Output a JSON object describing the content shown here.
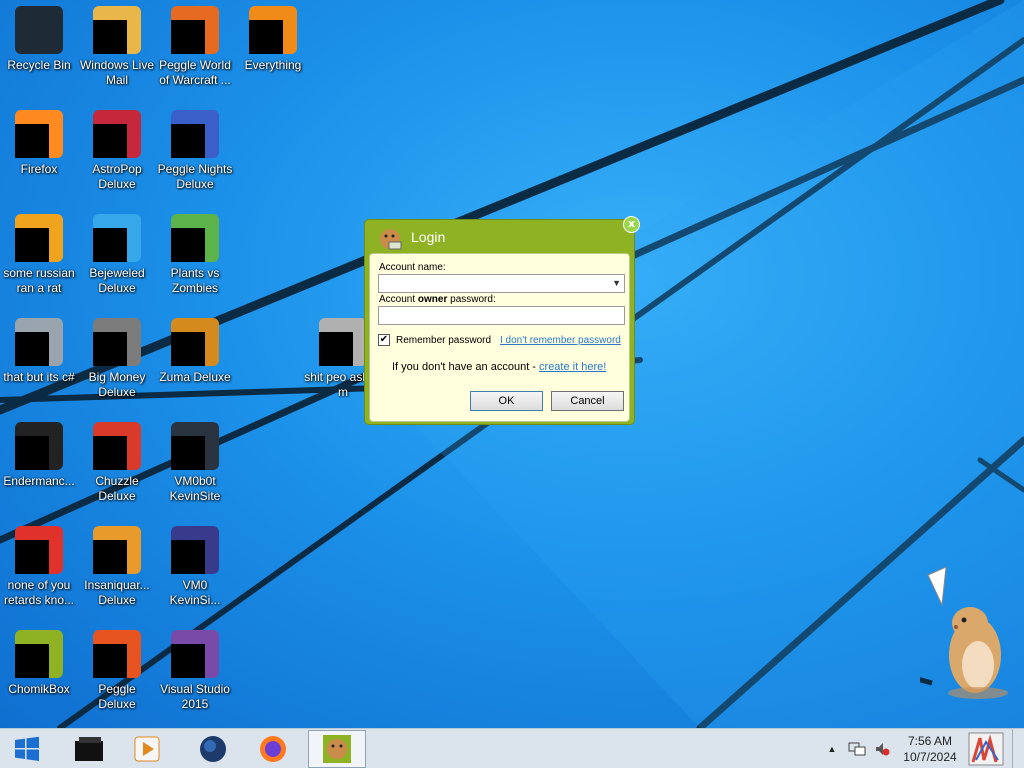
{
  "desktop": {
    "icons": [
      {
        "label": "Recycle Bin",
        "icon": "recycle-bin-icon",
        "color": "#1e2a36"
      },
      {
        "label": "Windows Live Mail",
        "icon": "mail-icon",
        "color": "#e9b64a"
      },
      {
        "label": "Peggle World of Warcraft ...",
        "icon": "peggle-icon",
        "color": "#e66a1f"
      },
      {
        "label": "Everything",
        "icon": "search-magnifier-icon",
        "color": "#f08a18"
      },
      {
        "label": "Firefox",
        "icon": "firefox-icon",
        "color": "#ff8a1f"
      },
      {
        "label": "AstroPop Deluxe",
        "icon": "astropop-icon",
        "color": "#c4283a"
      },
      {
        "label": "Peggle Nights Deluxe",
        "icon": "peggle-nights-icon",
        "color": "#3a5fc8"
      },
      {
        "label": "some russian ran a rat",
        "icon": "app-icon",
        "color": "#f0a41e"
      },
      {
        "label": "Bejeweled Deluxe",
        "icon": "gem-icon",
        "color": "#36a7e8"
      },
      {
        "label": "Plants vs Zombies",
        "icon": "plant-icon",
        "color": "#5bb34a"
      },
      {
        "label": "that but its c#",
        "icon": "window-stack-icon",
        "color": "#9aa4ae"
      },
      {
        "label": "Big Money Deluxe",
        "icon": "money-icon",
        "color": "#7c7c7c"
      },
      {
        "label": "Zuma Deluxe",
        "icon": "zuma-icon",
        "color": "#d48a1c"
      },
      {
        "label": "Endermanc...",
        "icon": "console-icon",
        "color": "#222222"
      },
      {
        "label": "Chuzzle Deluxe",
        "icon": "chuzzle-icon",
        "color": "#d93a2a"
      },
      {
        "label": "VM0b0t KevinSite",
        "icon": "terminal-icon",
        "color": "#2a3440"
      },
      {
        "label": "none of you retards kno...",
        "icon": "opera-icon",
        "color": "#e0312a"
      },
      {
        "label": "Insaniquar... Deluxe",
        "icon": "fish-icon",
        "color": "#e89a2a"
      },
      {
        "label": "VM0 KevinSi...",
        "icon": "document-icon",
        "color": "#3a3a8c"
      },
      {
        "label": "ChomikBox",
        "icon": "hamster-icon",
        "color": "#8fb124"
      },
      {
        "label": "Peggle Deluxe",
        "icon": "peggle-deluxe-icon",
        "color": "#e8541f"
      },
      {
        "label": "Visual Studio 2015",
        "icon": "visual-studio-icon",
        "color": "#7a4aa8"
      },
      {
        "label": "shit peo asked m",
        "icon": "folder-icon",
        "color": "#b0b0b0"
      }
    ]
  },
  "login": {
    "title": "Login",
    "close_glyph": "x",
    "account_label": "Account name:",
    "account_value": "",
    "password_label_pre": "Account ",
    "password_label_bold": "owner",
    "password_label_post": " password:",
    "password_value": "",
    "remember_label": "Remember password",
    "remember_checked": "✔",
    "forgot_link": "I don't remember password",
    "signup_text": "If you don't have an account - ",
    "signup_link": "create it here!",
    "ok_label": "OK",
    "cancel_label": "Cancel"
  },
  "taskbar": {
    "tray_arrow": "▲",
    "time": "7:56 AM",
    "date": "10/7/2024",
    "colors": {
      "bar": "#dbe3ec",
      "start": "#1a6fd0"
    }
  }
}
